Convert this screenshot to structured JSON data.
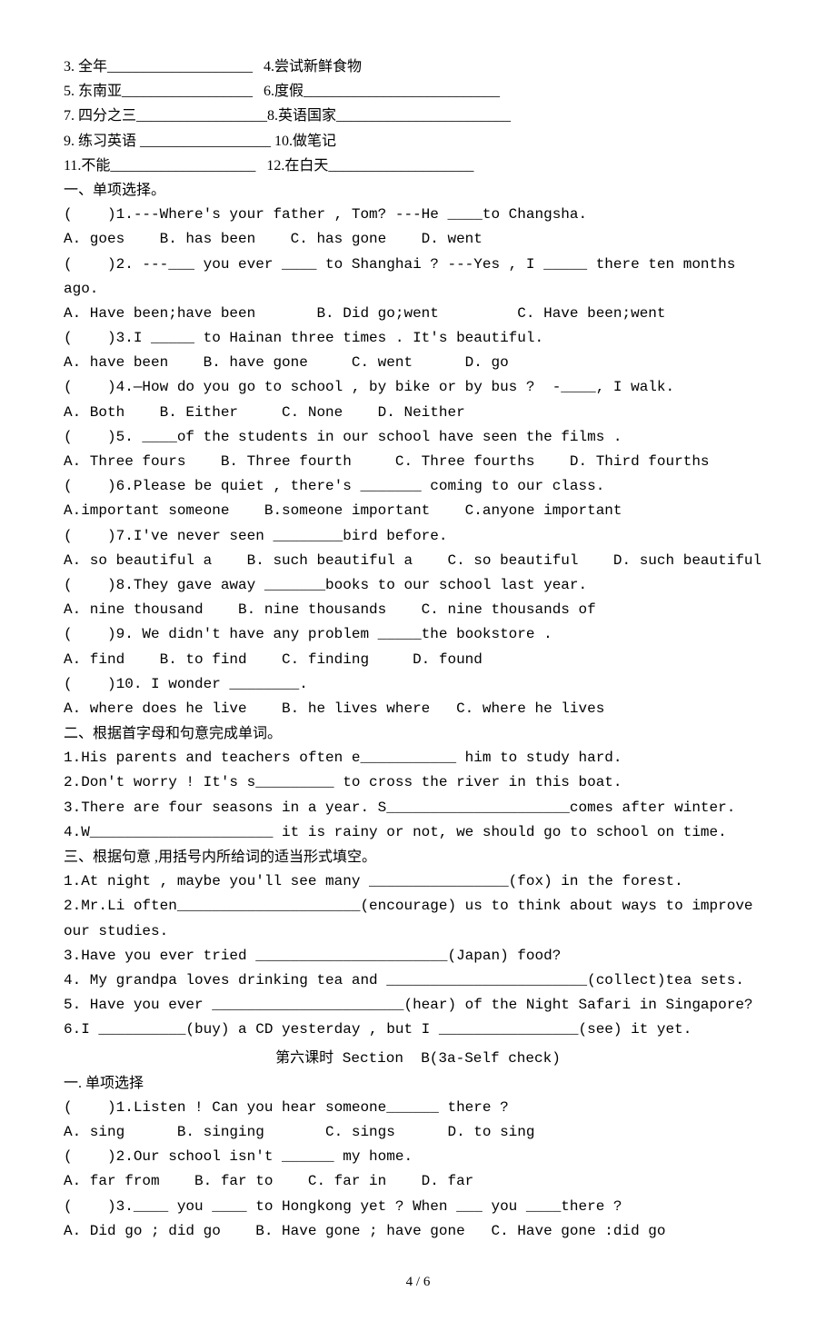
{
  "vocab": {
    "l3": "3. 全年____________________   4.尝试新鲜食物",
    "l5": "5. 东南亚__________________   6.度假___________________________",
    "l7": "7. 四分之三__________________8.英语国家________________________",
    "l9": "9. 练习英语 __________________ 10.做笔记",
    "l11": "11.不能____________________   12.在白天____________________"
  },
  "sec1_title": "一、单项选择。",
  "sec1": {
    "q1": "(    )1.---Where's your father , Tom? ---He ____to Changsha.",
    "q1o": "A. goes    B. has been    C. has gone    D. went",
    "q2": "(    )2. ---___ you ever ____ to Shanghai ? ---Yes , I _____ there ten months ago.",
    "q2o": "A. Have been;have been       B. Did go;went         C. Have been;went",
    "q3": "(    )3.I _____ to Hainan three times . It's beautiful.",
    "q3o": "A. have been    B. have gone     C. went      D. go",
    "q4": "(    )4.—How do you go to school , by bike or by bus ?  -____, I walk.",
    "q4o": "A. Both    B. Either     C. None    D. Neither",
    "q5": "(    )5. ____of the students in our school have seen the films .",
    "q5o": "A. Three fours    B. Three fourth     C. Three fourths    D. Third fourths",
    "q6": "(    )6.Please be quiet , there's _______ coming to our class.",
    "q6o": "A.important someone    B.someone important    C.anyone important",
    "q7": "(    )7.I've never seen ________bird before.",
    "q7o": "A. so beautiful a    B. such beautiful a    C. so beautiful    D. such beautiful",
    "q8": "(    )8.They gave away _______books to our school last year.",
    "q8o": "A. nine thousand    B. nine thousands    C. nine thousands of",
    "q9": "(    )9. We didn't have any problem _____the bookstore .",
    "q9o": "A. find    B. to find    C. finding     D. found",
    "q10": "(    )10. I wonder ________.",
    "q10o": "A. where does he live    B. he lives where   C. where he lives"
  },
  "sec2_title": "二、根据首字母和句意完成单词。",
  "sec2": {
    "q1": "1.His parents and teachers often e___________ him to study hard.",
    "q2": "2.Don't worry ! It's s_________ to cross the river in this boat.",
    "q3": "3.There are four seasons in a year. S_____________________comes after winter.",
    "q4": "4.W_____________________ it is rainy or not, we should go to school on time."
  },
  "sec3_title": "三、根据句意 ,用括号内所给词的适当形式填空。",
  "sec3": {
    "q1": "1.At night , maybe you'll see many ________________(fox) in the forest.",
    "q2": "2.Mr.Li often_____________________(encourage) us to think about ways to improve our studies.",
    "q3": "3.Have you ever tried ______________________(Japan) food?",
    "q4": "4. My grandpa loves drinking tea and _______________________(collect)tea sets.",
    "q5": "5. Have you ever ______________________(hear) of the Night Safari in Singapore?",
    "q6": "6.I __________(buy) a CD yesterday , but I ________________(see) it yet."
  },
  "lesson_title": "第六课时 Section  B(3a-Self check)",
  "sec4_title": "一. 单项选择",
  "sec4": {
    "q1": "(    )1.Listen ! Can you hear someone______ there ?",
    "q1o": "A. sing      B. singing       C. sings      D. to sing",
    "q2": "(    )2.Our school isn't ______ my home.",
    "q2o": "A. far from    B. far to    C. far in    D. far",
    "q3": "(    )3.____ you ____ to Hongkong yet ? When ___ you ____there ?",
    "q3o": "A. Did go ; did go    B. Have gone ; have gone   C. Have gone :did go"
  },
  "footer": "4 / 6"
}
